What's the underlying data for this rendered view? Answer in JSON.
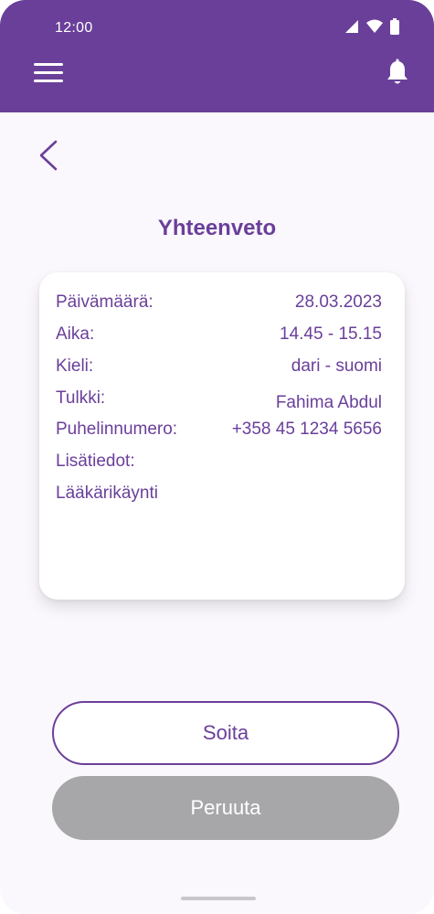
{
  "status_bar": {
    "time": "12:00"
  },
  "colors": {
    "accent": "#6a3f9a",
    "disabled": "#a7a6a9",
    "background": "#fbf8fd"
  },
  "icons": [
    "menu-icon",
    "bell-icon",
    "back-arrow-icon",
    "signal-icon",
    "wifi-icon",
    "battery-icon"
  ],
  "page": {
    "title": "Yhteenveto"
  },
  "summary": {
    "date_label": "Päivämäärä:",
    "date_value": "28.03.2023",
    "time_label": "Aika:",
    "time_value": "14.45 - 15.15",
    "language_label": "Kieli:",
    "language_value": "dari - suomi",
    "interpreter_label": "Tulkki:",
    "interpreter_value": "Fahima Abdul",
    "phone_label": "Puhelinnumero:",
    "phone_value": "+358 45 1234 5656",
    "extra_label": "Lisätiedot:",
    "extra_value": "Lääkärikäynti"
  },
  "actions": {
    "call_label": "Soita",
    "cancel_label": "Peruuta"
  }
}
